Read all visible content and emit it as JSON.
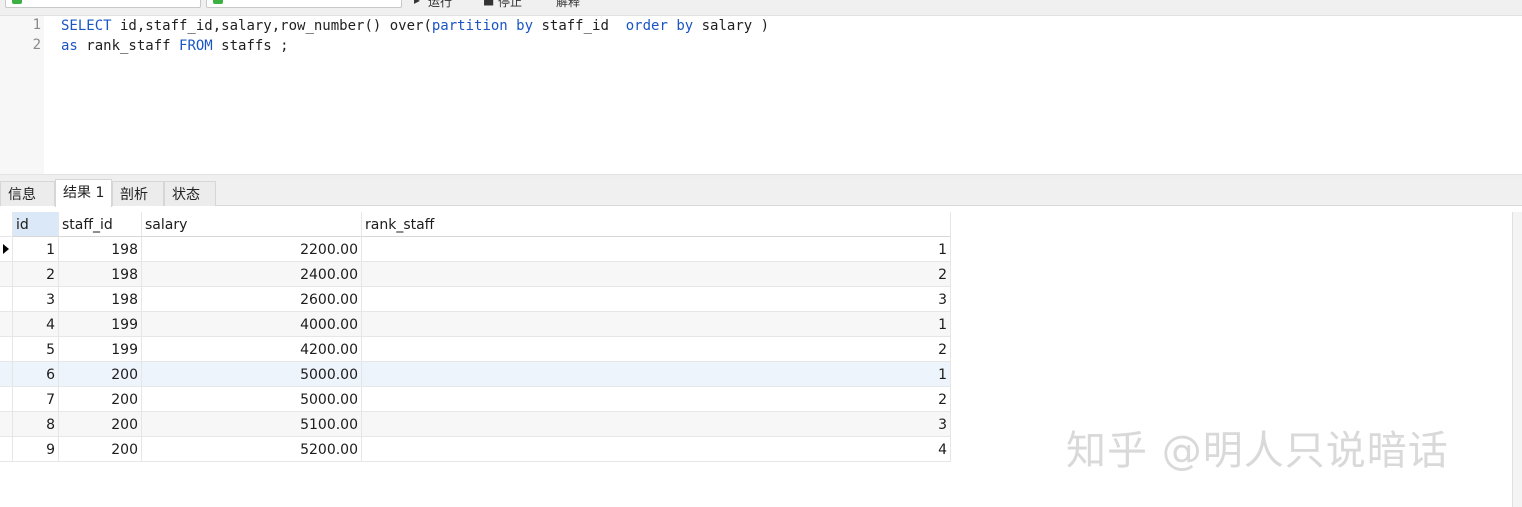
{
  "toolbar": {
    "run_label": "运行",
    "stop_label": "停止",
    "explain_label": "解释",
    "combo_icon_color": "#3cb043"
  },
  "editor": {
    "line_numbers": [
      "1",
      "2"
    ],
    "line1": {
      "kw1": "SELECT",
      "t1": " id,staff_id,salary,row_number() over(",
      "kw2": "partition by",
      "t2": " staff_id  ",
      "kw3": "order by",
      "t3": " salary )"
    },
    "line2": {
      "kw1": "as",
      "t1": " rank_staff ",
      "kw2": "FROM",
      "t2": " staffs ;"
    },
    "keyword_color": "#1a55c6"
  },
  "tabs": [
    {
      "label": "信息"
    },
    {
      "label": "结果 1"
    },
    {
      "label": "剖析"
    },
    {
      "label": "状态"
    }
  ],
  "active_tab": "结果 1",
  "result": {
    "columns": [
      "id",
      "staff_id",
      "salary",
      "rank_staff"
    ],
    "rows": [
      [
        "1",
        "198",
        "2200.00",
        "1"
      ],
      [
        "2",
        "198",
        "2400.00",
        "2"
      ],
      [
        "3",
        "198",
        "2600.00",
        "3"
      ],
      [
        "4",
        "199",
        "4000.00",
        "1"
      ],
      [
        "5",
        "199",
        "4200.00",
        "2"
      ],
      [
        "6",
        "200",
        "5000.00",
        "1"
      ],
      [
        "7",
        "200",
        "5000.00",
        "2"
      ],
      [
        "8",
        "200",
        "5100.00",
        "3"
      ],
      [
        "9",
        "200",
        "5200.00",
        "4"
      ]
    ],
    "current_row": "1",
    "highlighted_row": "6"
  },
  "watermark": "知乎 @明人只说暗话"
}
